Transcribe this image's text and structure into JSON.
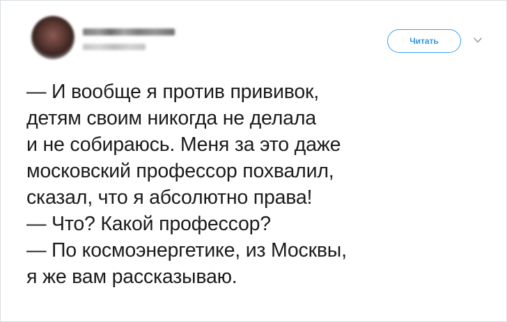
{
  "header": {
    "follow_label": "Читать"
  },
  "icons": {
    "avatar": "avatar-blurred",
    "dropdown": "chevron-down-icon"
  },
  "colors": {
    "accent": "#2f95e6",
    "text": "#1b1b1b",
    "chevron": "#8899a6"
  },
  "tweet": {
    "lines": [
      "— И вообще я против прививок,",
      "детям своим никогда не делала",
      "и не собираюсь. Меня за это даже",
      "московский профессор похвалил,",
      "сказал, что я абсолютно права!",
      "— Что? Какой профессор?",
      "— По космоэнергетике, из Москвы,",
      "я же вам рассказываю."
    ]
  }
}
